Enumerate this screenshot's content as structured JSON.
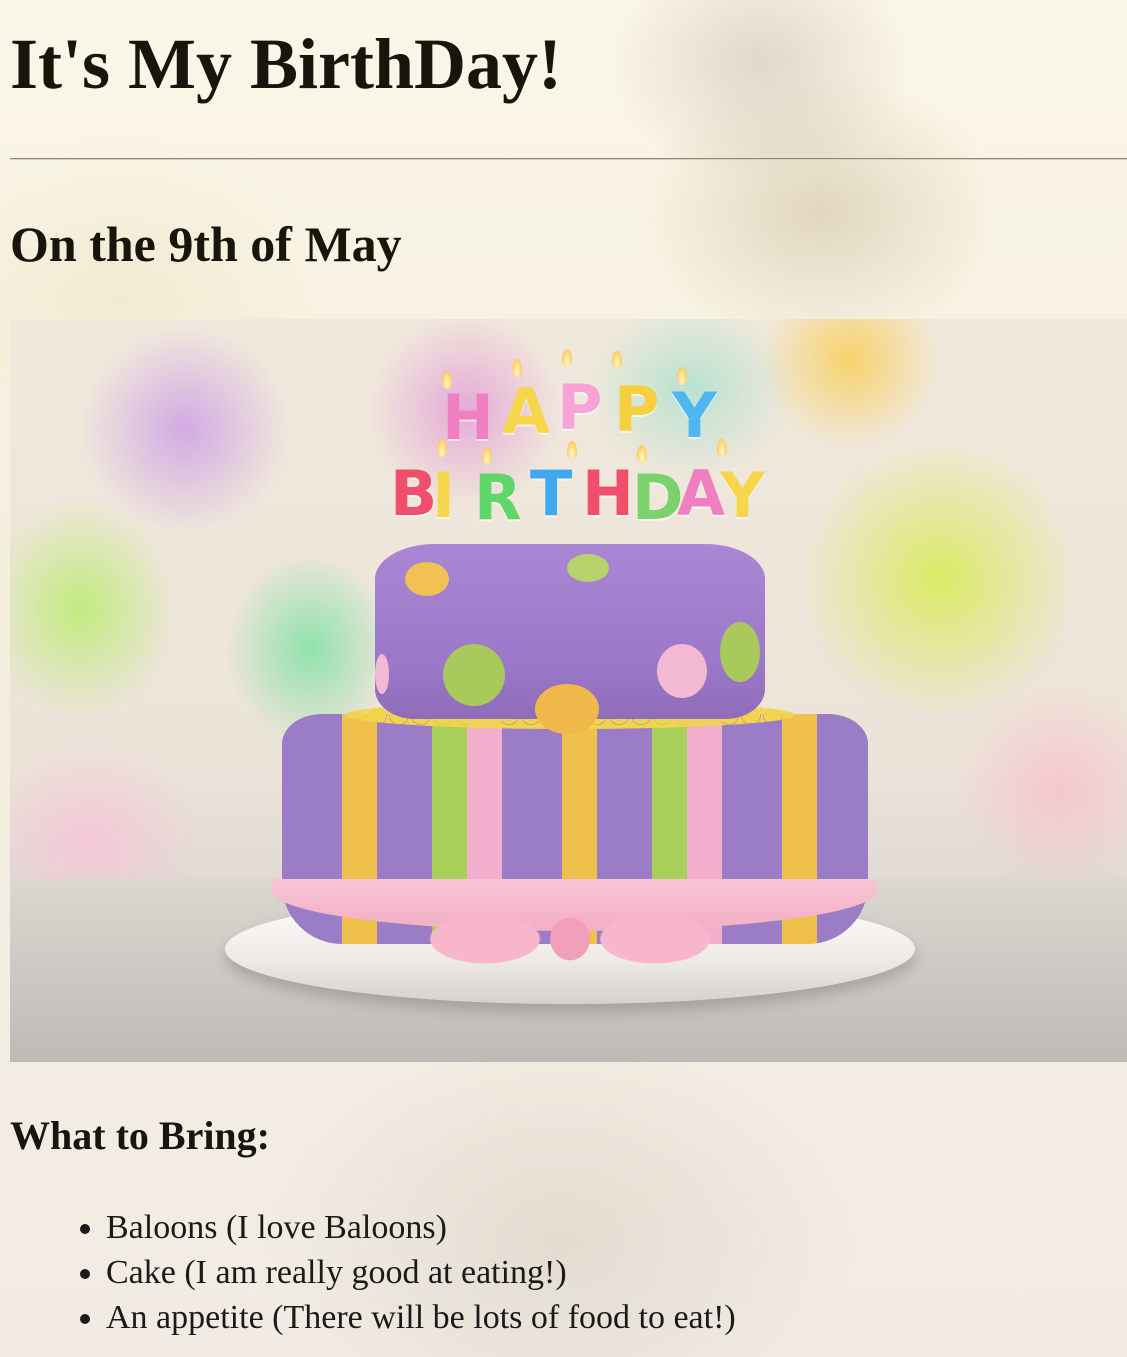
{
  "page": {
    "title": "It's My BirthDay!",
    "date_heading": "On the 9th of May",
    "image": {
      "description_name": "birthday-cake-photo",
      "candle_text_line1": "HAPPY",
      "candle_text_line2": "BIRTHDAY"
    },
    "bring_heading": "What to Bring:",
    "bring_items": [
      "Baloons (I love Baloons)",
      "Cake (I am really good at eating!)",
      "An appetite (There will be lots of food to eat!)"
    ]
  },
  "colors": {
    "text": "#17150c",
    "background": "#f7f1df",
    "rule": "#8d877a"
  }
}
